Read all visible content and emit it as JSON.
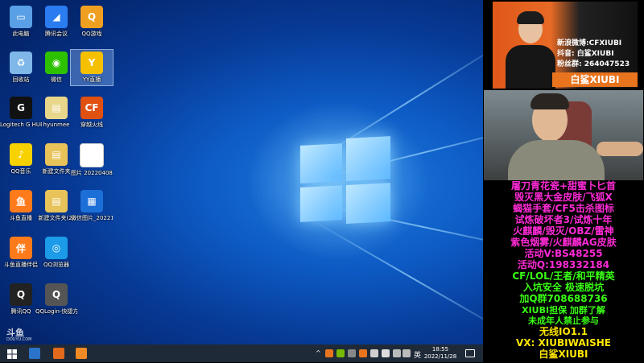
{
  "desktop": {
    "icons": [
      {
        "label": "此电脑",
        "color": "#5aa0e6",
        "glyph": "▭"
      },
      {
        "label": "腾讯会议",
        "color": "#2a7cf0",
        "glyph": "◢"
      },
      {
        "label": "QQ游戏",
        "color": "#f0a020",
        "glyph": "Q"
      },
      {
        "label": "回收站",
        "color": "#7fb8e8",
        "glyph": "♻"
      },
      {
        "label": "微信",
        "color": "#2dc100",
        "glyph": "◉"
      },
      {
        "label": "YY直播",
        "color": "#f5c000",
        "glyph": "Y"
      },
      {
        "label": "Logitech G HUB",
        "color": "#111111",
        "glyph": "G"
      },
      {
        "label": "hyunmee",
        "color": "#e8d68a",
        "glyph": "▤"
      },
      {
        "label": "穿越火线",
        "color": "#e05010",
        "glyph": "CF"
      },
      {
        "label": "QQ音乐",
        "color": "#f7d100",
        "glyph": "♪"
      },
      {
        "label": "新建文件夹",
        "color": "#e8c35a",
        "glyph": "▤"
      },
      {
        "label": "图片 20220408...",
        "color": "#ffffff",
        "glyph": ""
      },
      {
        "label": "斗鱼直播",
        "color": "#ff7a1a",
        "glyph": "鱼"
      },
      {
        "label": "新建文件夹(2)",
        "color": "#e8c35a",
        "glyph": "▤"
      },
      {
        "label": "微信图片_2022111...",
        "color": "#1d6fd8",
        "glyph": "▦"
      },
      {
        "label": "斗鱼直播伴侣",
        "color": "#ff7a1a",
        "glyph": "伴"
      },
      {
        "label": "QQ浏览器",
        "color": "#1b9be8",
        "glyph": "◎"
      },
      {
        "label": "腾讯QQ",
        "color": "#222222",
        "glyph": "Q"
      },
      {
        "label": "QQLogin-快捷方式",
        "color": "#555555",
        "glyph": "Q"
      }
    ],
    "watermark": {
      "brand": "斗鱼",
      "url": "DOUYU.COM"
    }
  },
  "taskbar": {
    "clock_time": "18:55",
    "clock_date": "2022/11/28",
    "ime": "英",
    "icons": [
      "start-icon",
      "search-icon",
      "cf-app-icon",
      "douyu-app-icon"
    ]
  },
  "streamer": {
    "weibo": "新浪微博:CFXIUBI",
    "douyin": "抖音:  白鲨XIUBI",
    "fans": "粉丝群:  264047523",
    "name_banner": "白鲨XIUBI"
  },
  "promo": {
    "lines": [
      {
        "text": "屠刀青花瓷+甜蜜卜匕首",
        "color": "#ff2bd6",
        "size": 12
      },
      {
        "text": "毁灭黑大金皮肤/飞狐X",
        "color": "#ff2bd6",
        "size": 12
      },
      {
        "text": "蝎猫手套/CF5击杀图标",
        "color": "#ff2bd6",
        "size": 12
      },
      {
        "text": "试炼破坏者3/试炼十年",
        "color": "#ff2bd6",
        "size": 12
      },
      {
        "text": "火麒麟/毁灭/OBZ/雷神",
        "color": "#ff2bd6",
        "size": 12
      },
      {
        "text": "紫色烟雾/火麒麟AG皮肤",
        "color": "#ff2bd6",
        "size": 12
      },
      {
        "text": "活动V:BS48255",
        "color": "#ff2bd6",
        "size": 12
      },
      {
        "text": "活动Q:198332184",
        "color": "#ff2bd6",
        "size": 12
      },
      {
        "text": "CF/LOL/王者/和平精英",
        "color": "#39ff14",
        "size": 12
      },
      {
        "text": "入坑安全  极速脱坑",
        "color": "#39ff14",
        "size": 12
      },
      {
        "text": "加Q群708688736",
        "color": "#39ff14",
        "size": 12
      },
      {
        "text": "XIUBI担保  加群了解",
        "color": "#39ff14",
        "size": 11
      },
      {
        "text": "未成年人禁止参与",
        "color": "#39ff14",
        "size": 11
      },
      {
        "text": "无线IO1.1",
        "color": "#ffe600",
        "size": 12
      },
      {
        "text": "VX: XIUBIWAISHE",
        "color": "#ffe600",
        "size": 12
      },
      {
        "text": "白鲨XIUBI",
        "color": "#ffe600",
        "size": 12
      }
    ]
  }
}
